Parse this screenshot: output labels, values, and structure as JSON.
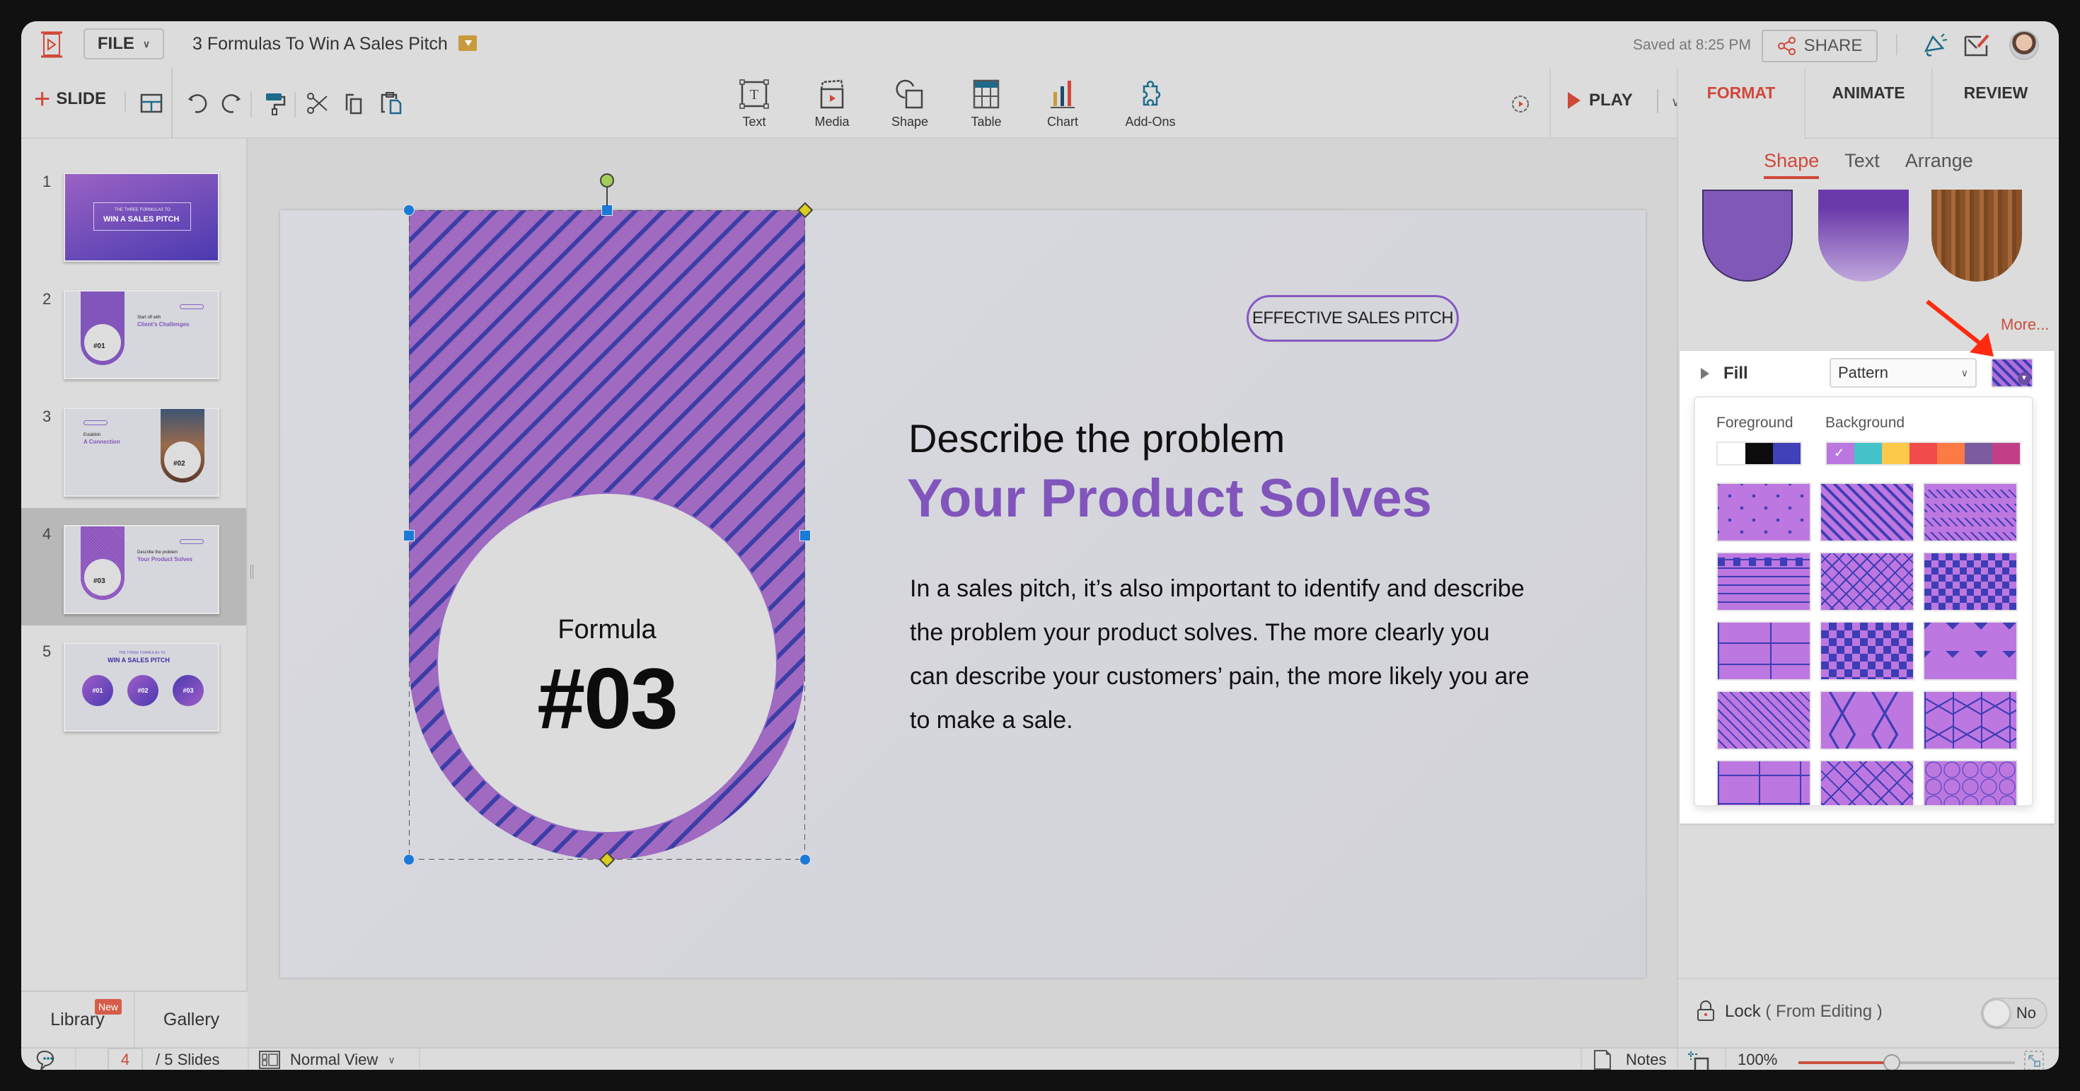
{
  "app": {
    "file_menu": "FILE",
    "document_title": "3 Formulas To Win A Sales Pitch",
    "saved_status": "Saved at 8:25 PM",
    "share_label": "SHARE"
  },
  "toolbar": {
    "add_slide_label": "SLIDE",
    "insert_items": [
      {
        "label": "Text",
        "icon": "text-box-icon"
      },
      {
        "label": "Media",
        "icon": "clapperboard-icon"
      },
      {
        "label": "Shape",
        "icon": "shape-icon"
      },
      {
        "label": "Table",
        "icon": "table-icon"
      },
      {
        "label": "Chart",
        "icon": "bar-chart-icon"
      },
      {
        "label": "Add-Ons",
        "icon": "puzzle-icon"
      }
    ],
    "play_label": "PLAY"
  },
  "right_tabs": [
    {
      "label": "FORMAT",
      "active": true
    },
    {
      "label": "ANIMATE",
      "active": false
    },
    {
      "label": "REVIEW",
      "active": false
    }
  ],
  "format_panel": {
    "subtabs": [
      {
        "label": "Shape",
        "active": true
      },
      {
        "label": "Text",
        "active": false
      },
      {
        "label": "Arrange",
        "active": false
      }
    ],
    "style_presets": [
      "solid-purple",
      "purple-gradient",
      "wood-texture"
    ],
    "more_label": "More...",
    "fill": {
      "label": "Fill",
      "type_value": "Pattern",
      "foreground_label": "Foreground",
      "background_label": "Background",
      "foreground_colors": [
        "#ffffff",
        "#0c0c0c",
        "#4040b8"
      ],
      "background_colors": [
        "#bb77e0",
        "#44c2c8",
        "#fdc94a",
        "#f24b4b",
        "#fc7a43",
        "#7b5c9e",
        "#c23f88"
      ],
      "selected_background": "#bb77e0",
      "patterns": [
        "dots",
        "wide-diagonal",
        "dashed-diagonal",
        "dashed-horizontal",
        "diagonal-cross",
        "diamonds",
        "bricks",
        "checkerboard",
        "zigzag",
        "diagonal-blocks",
        "pentagons",
        "cubes",
        "interlocking",
        "nested-diamonds",
        "hexagons",
        "more-1",
        "more-2",
        "more-3"
      ]
    },
    "lock": {
      "label": "Lock",
      "sublabel": "( From Editing )",
      "toggle_value": "No"
    }
  },
  "slides_panel": {
    "current": 4,
    "slides": [
      {
        "number": "1",
        "kicker": "THE THREE FORMULAS TO",
        "title": "WIN A SALES PITCH"
      },
      {
        "number": "2",
        "kicker": "Start off with",
        "title": "Client's Challenges",
        "formula": "#01"
      },
      {
        "number": "3",
        "kicker": "Establish",
        "title": "A Connection",
        "formula": "#02"
      },
      {
        "number": "4",
        "kicker": "Describe the problem",
        "title": "Your Product Solves",
        "formula": "#03"
      },
      {
        "number": "5",
        "kicker": "THE THREE FORMULAS TO",
        "title": "WIN A SALES PITCH",
        "circles": [
          "#01",
          "#02",
          "#03"
        ]
      }
    ],
    "library_label": "Library",
    "library_badge": "New",
    "gallery_label": "Gallery"
  },
  "slide": {
    "pill": "EFFECTIVE SALES PITCH",
    "subheading": "Describe the problem",
    "heading": "Your Product Solves",
    "body": "In a sales pitch, it’s also important to identify and describe the problem your product solves. The more clearly you can describe your customers’ pain, the more likely you are to make a sale.",
    "formula_label": "Formula",
    "formula_number": "#03",
    "shape_fill": {
      "pattern": "wide-diagonal",
      "background": "#a06ac0",
      "foreground": "#3d3da8"
    }
  },
  "statusbar": {
    "current_page": "4",
    "total_label": "/ 5 Slides",
    "view_mode": "Normal View",
    "notes_label": "Notes",
    "zoom_value": "100%",
    "zoom_fraction": 0.43
  },
  "colors": {
    "accent": "#d0483a",
    "brand_purple": "#8155bb"
  }
}
